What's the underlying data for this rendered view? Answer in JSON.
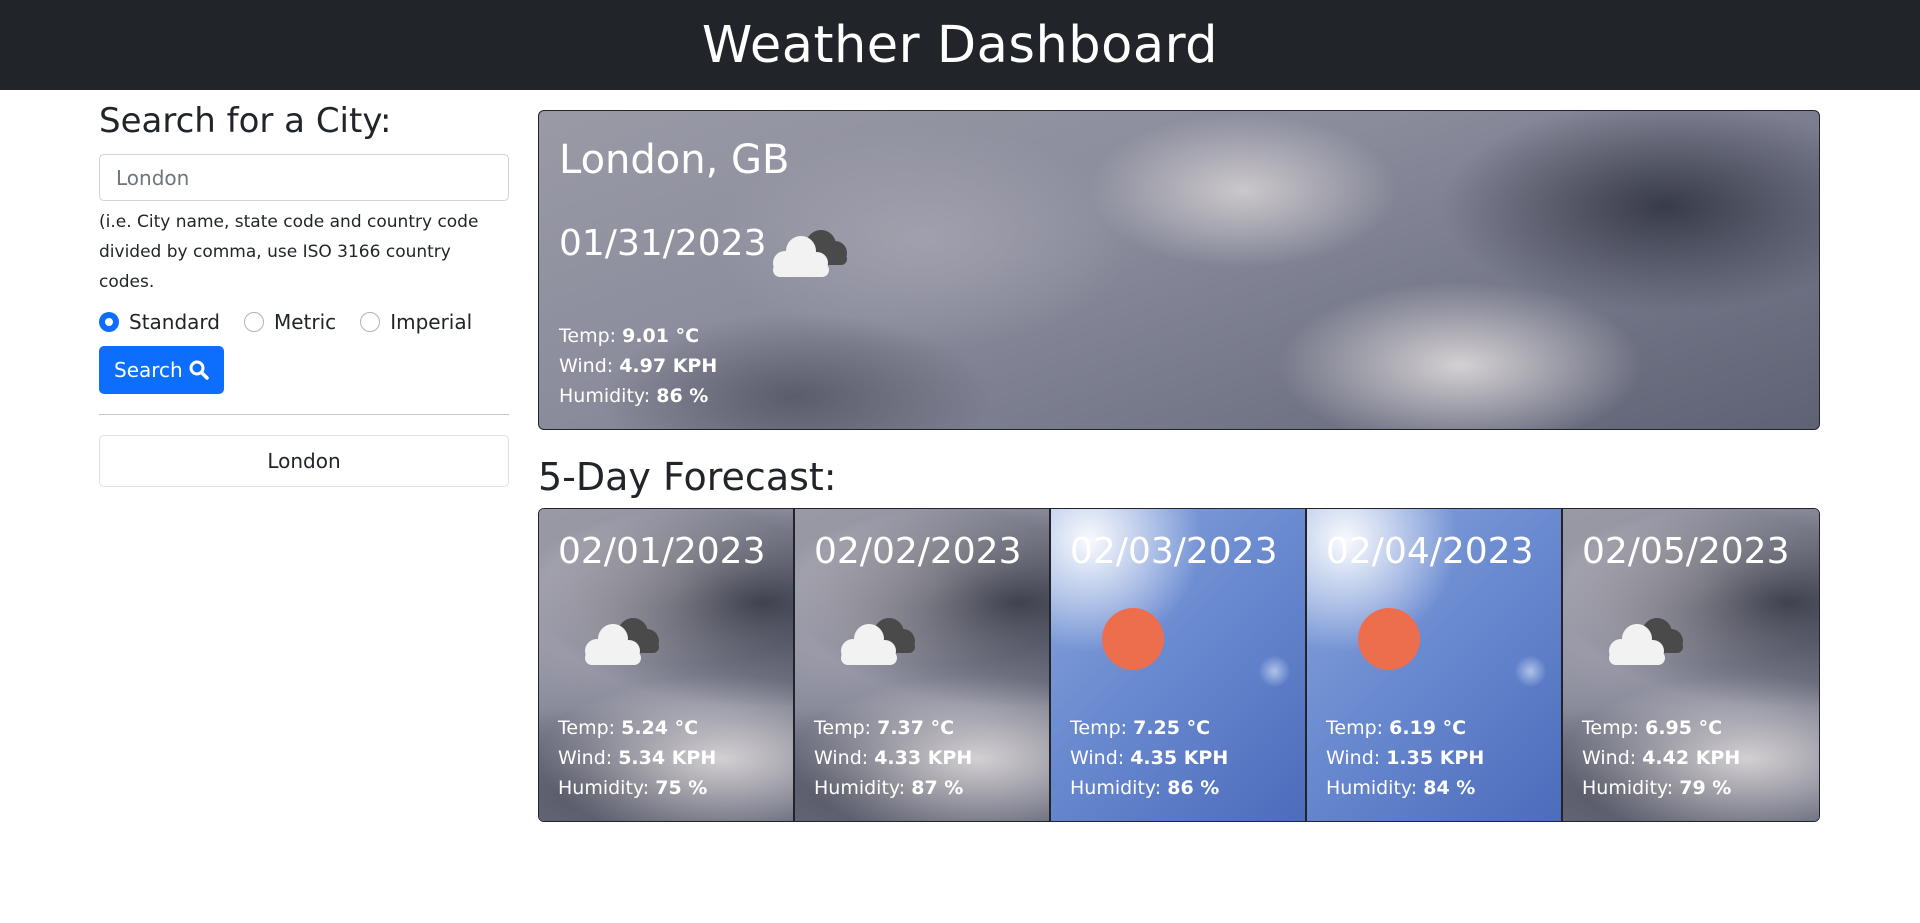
{
  "header": {
    "title": "Weather Dashboard"
  },
  "sidebar": {
    "title": "Search for a City:",
    "input_value": "London",
    "input_placeholder": "London",
    "hint": "(i.e. City name, state code and country code divided by comma, use ISO 3166 country codes.",
    "units": [
      {
        "label": "Standard",
        "checked": true
      },
      {
        "label": "Metric",
        "checked": false
      },
      {
        "label": "Imperial",
        "checked": false
      }
    ],
    "search_label": "Search",
    "search_icon": "magnifier-icon",
    "history": [
      "London"
    ]
  },
  "labels": {
    "temp": "Temp:",
    "wind": "Wind:",
    "humidity": "Humidity:"
  },
  "current": {
    "city": "London,  GB",
    "date": "01/31/2023",
    "icon": "cloudy-icon",
    "temp": "9.01 °C",
    "wind": "4.97 KPH",
    "humidity": "86 %"
  },
  "forecast": {
    "title": "5-Day Forecast:",
    "days": [
      {
        "date": "02/01/2023",
        "icon": "cloudy-icon",
        "temp": "5.24 °C",
        "wind": "5.34 KPH",
        "humidity": "75 %"
      },
      {
        "date": "02/02/2023",
        "icon": "cloudy-icon",
        "temp": "7.37 °C",
        "wind": "4.33 KPH",
        "humidity": "87 %"
      },
      {
        "date": "02/03/2023",
        "icon": "sun-icon",
        "temp": "7.25 °C",
        "wind": "4.35 KPH",
        "humidity": "86 %"
      },
      {
        "date": "02/04/2023",
        "icon": "sun-icon",
        "temp": "6.19 °C",
        "wind": "1.35 KPH",
        "humidity": "84 %"
      },
      {
        "date": "02/05/2023",
        "icon": "cloudy-icon",
        "temp": "6.95 °C",
        "wind": "4.42 KPH",
        "humidity": "79 %"
      }
    ]
  },
  "colors": {
    "header_bg": "#212529",
    "primary": "#0d6efd",
    "sun": "#ec6e4c"
  }
}
